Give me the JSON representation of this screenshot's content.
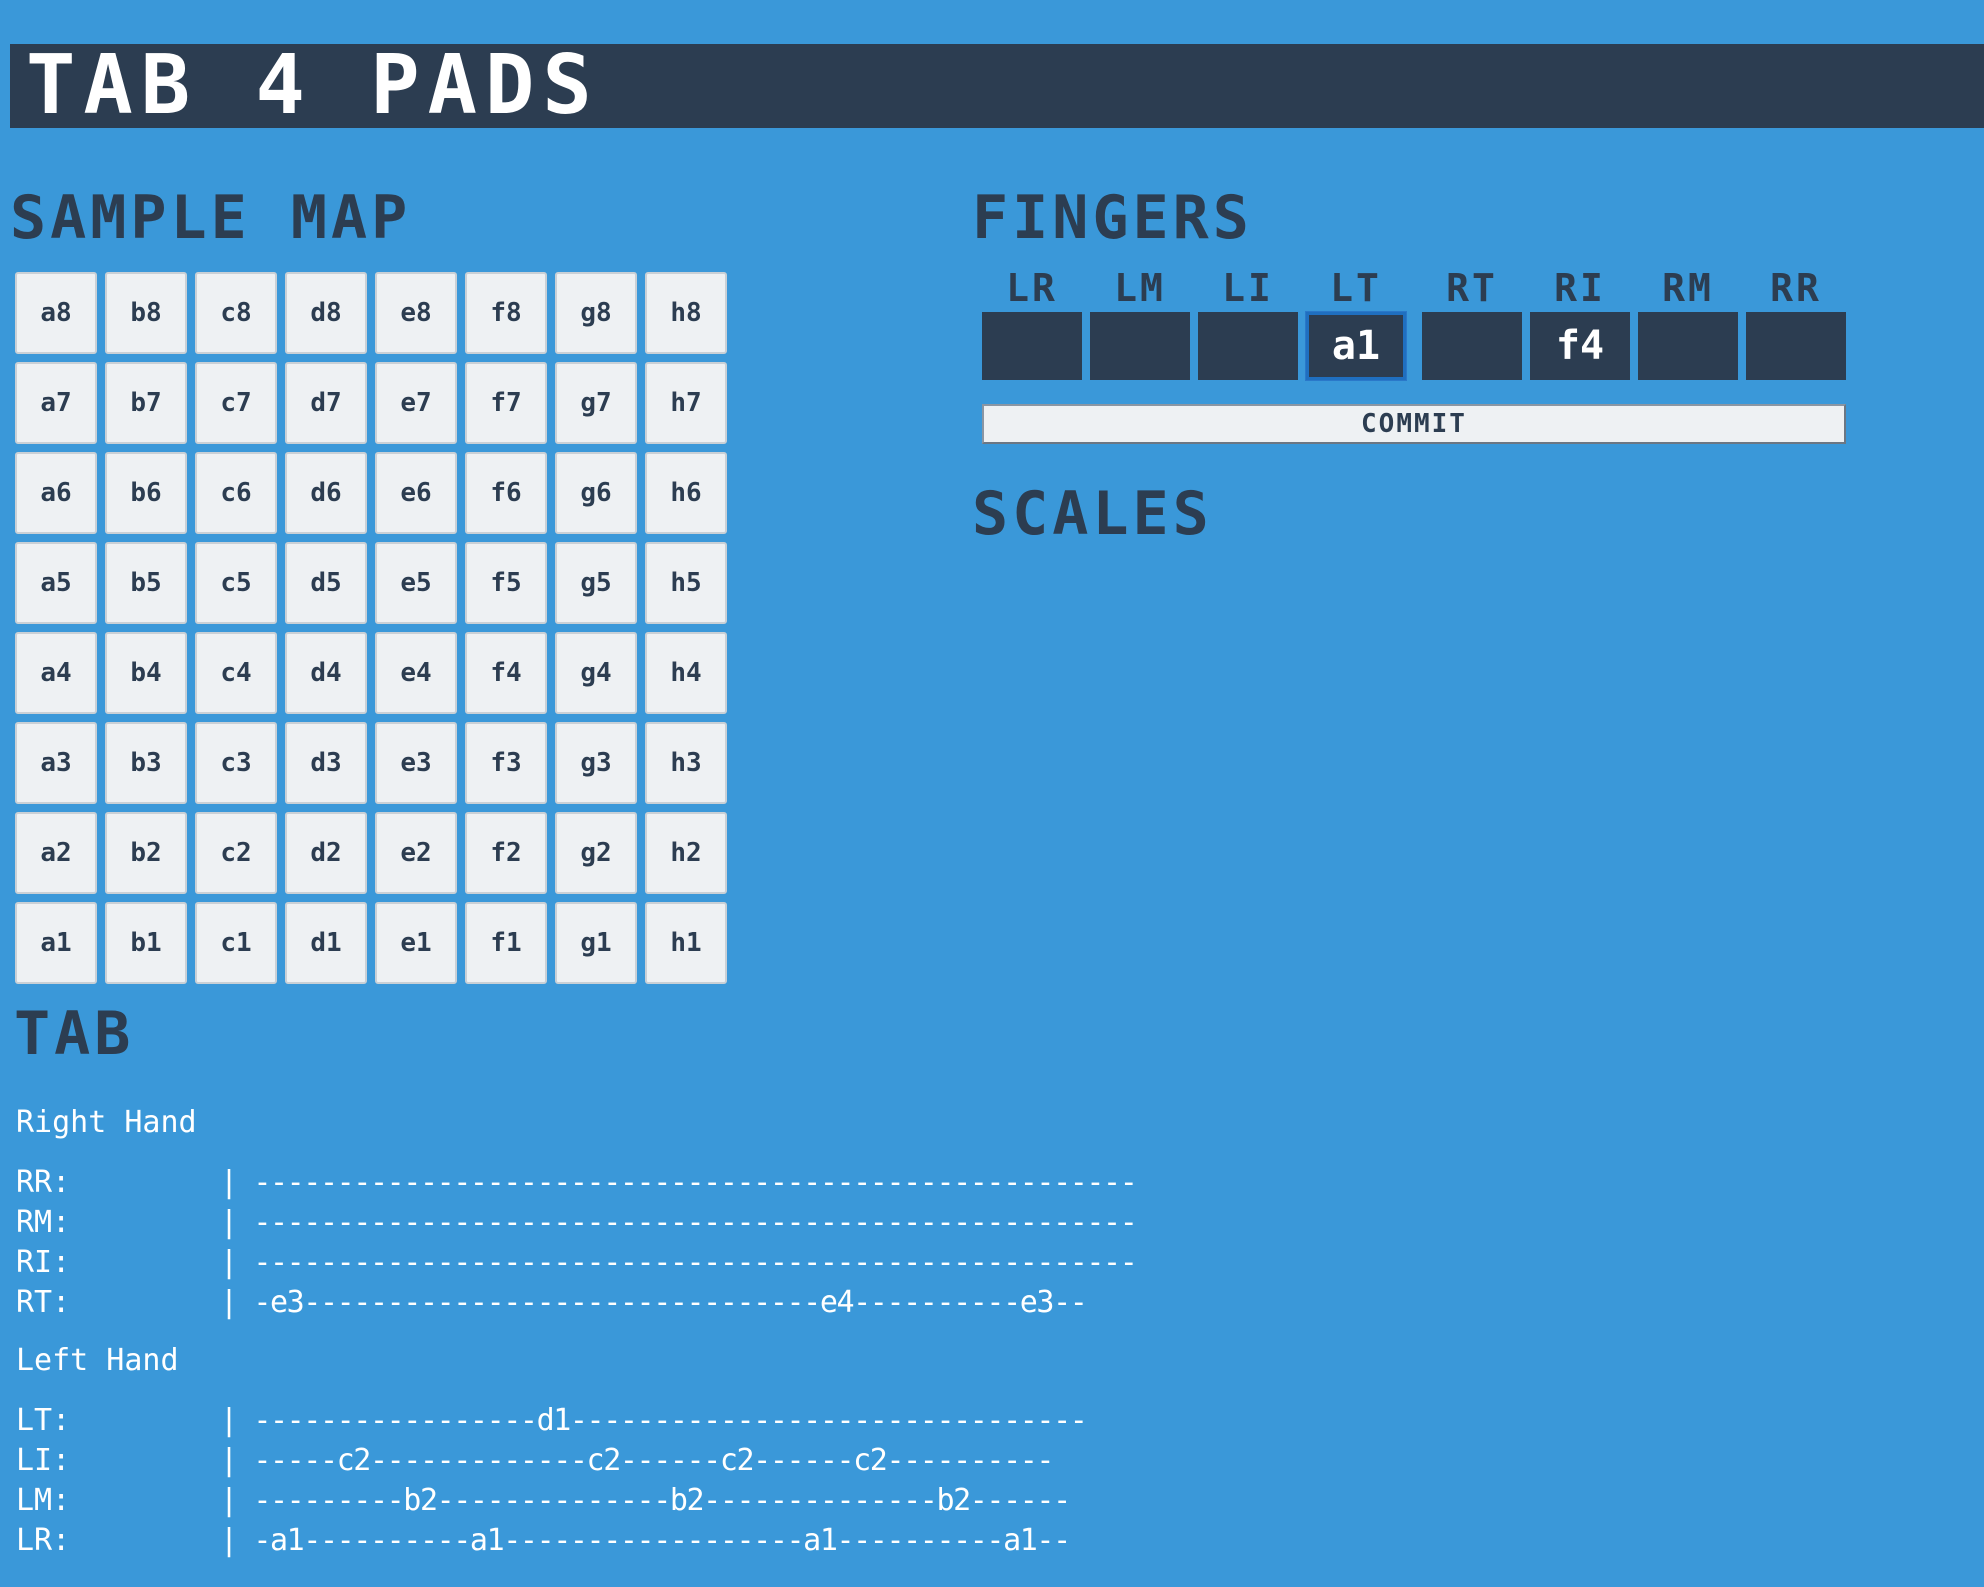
{
  "app": {
    "title": "TAB 4 PADS"
  },
  "sample_map": {
    "heading": "SAMPLE MAP",
    "pads": [
      "a8",
      "b8",
      "c8",
      "d8",
      "e8",
      "f8",
      "g8",
      "h8",
      "a7",
      "b7",
      "c7",
      "d7",
      "e7",
      "f7",
      "g7",
      "h7",
      "a6",
      "b6",
      "c6",
      "d6",
      "e6",
      "f6",
      "g6",
      "h6",
      "a5",
      "b5",
      "c5",
      "d5",
      "e5",
      "f5",
      "g5",
      "h5",
      "a4",
      "b4",
      "c4",
      "d4",
      "e4",
      "f4",
      "g4",
      "h4",
      "a3",
      "b3",
      "c3",
      "d3",
      "e3",
      "f3",
      "g3",
      "h3",
      "a2",
      "b2",
      "c2",
      "d2",
      "e2",
      "f2",
      "g2",
      "h2",
      "a1",
      "b1",
      "c1",
      "d1",
      "e1",
      "f1",
      "g1",
      "h1"
    ]
  },
  "fingers": {
    "heading": "FINGERS",
    "labels": [
      "LR",
      "LM",
      "LI",
      "LT",
      "RT",
      "RI",
      "RM",
      "RR"
    ],
    "slots": [
      "",
      "",
      "",
      "a1",
      "",
      "f4",
      "",
      ""
    ],
    "selected": "LT",
    "commit_label": "COMMIT"
  },
  "scales": {
    "heading": "SCALES"
  },
  "tab": {
    "heading": "TAB",
    "right_hand": {
      "label": "Right Hand",
      "rows": [
        {
          "name": "RR:",
          "line": "| -----------------------------------------------------"
        },
        {
          "name": "RM:",
          "line": "| -----------------------------------------------------"
        },
        {
          "name": "RI:",
          "line": "| -----------------------------------------------------"
        },
        {
          "name": "RT:",
          "line": "| -e3-------------------------------e4----------e3--"
        }
      ]
    },
    "left_hand": {
      "label": "Left Hand",
      "rows": [
        {
          "name": "LT:",
          "line": "| -----------------d1-------------------------------"
        },
        {
          "name": "LI:",
          "line": "| -----c2-------------c2------c2------c2----------"
        },
        {
          "name": "LM:",
          "line": "| ---------b2--------------b2--------------b2------"
        },
        {
          "name": "LR:",
          "line": "| -a1----------a1------------------a1----------a1--"
        }
      ]
    }
  }
}
